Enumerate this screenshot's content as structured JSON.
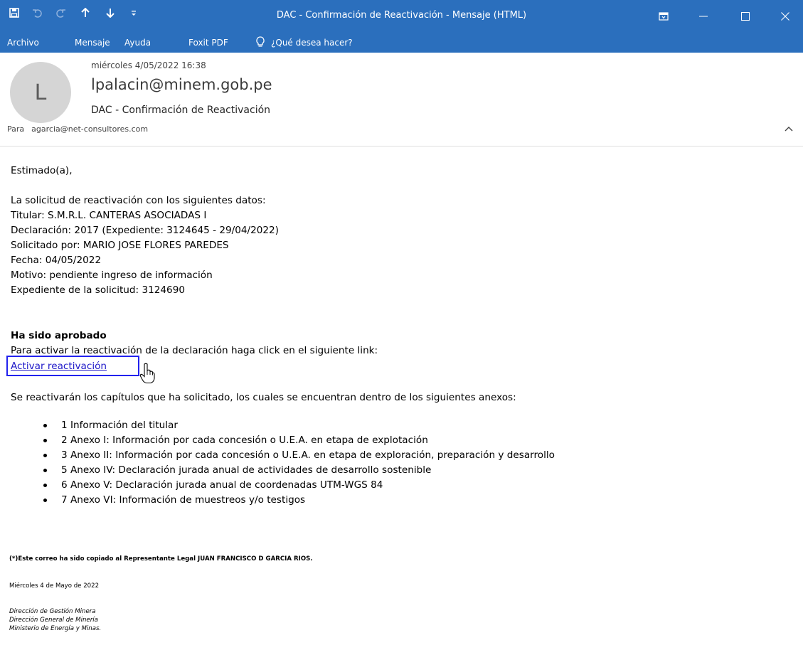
{
  "window": {
    "title": "DAC - Confirmación de Reactivación  -  Mensaje (HTML)",
    "qat_icons": [
      "save-icon",
      "undo-icon",
      "redo-icon",
      "up-arrow-icon",
      "down-arrow-icon",
      "customize-icon"
    ],
    "controls": [
      "ribbon-display-icon",
      "minimize-icon",
      "maximize-icon",
      "close-icon"
    ]
  },
  "ribbon": {
    "tabs": [
      "Archivo",
      "Mensaje",
      "Ayuda",
      "Foxit PDF"
    ],
    "tell_me": "¿Qué desea hacer?"
  },
  "message": {
    "date": "miércoles 4/05/2022 16:38",
    "avatar_initial": "L",
    "from": "lpalacin@minem.gob.pe",
    "subject": "DAC - Confirmación de Reactivación",
    "to_label": "Para",
    "to": "agarcia@net-consultores.com"
  },
  "body": {
    "greeting": "Estimado(a),",
    "intro": "La solicitud de reactivación con los siguientes datos:",
    "titular": "Titular: S.M.R.L. CANTERAS ASOCIADAS I",
    "declaracion": "Declaración: 2017 (Expediente: 3124645 - 29/04/2022)",
    "solicitado": "Solicitado por: MARIO JOSE FLORES PAREDES",
    "fecha": "Fecha: 04/05/2022",
    "motivo": "Motivo: pendiente ingreso de información",
    "expediente": "Expediente de la solicitud: 3124690",
    "status": "Ha sido aprobado",
    "instruction": "Para activar la reactivación de la declaración haga click en el siguiente link:",
    "link": "Activar reactivación",
    "capitulos": "Se reactivarán los capítulos que ha solicitado, los cuales se encuentran dentro de los siguientes anexos:",
    "anexos": [
      "1 Información del titular",
      "2 Anexo I: Información por cada concesión o U.E.A. en etapa de explotación",
      "3 Anexo II: Información por cada concesión o U.E.A. en etapa de exploración, preparación y desarrollo",
      "5 Anexo IV: Declaración jurada anual de actividades de desarrollo sostenible",
      "6 Anexo V: Declaración jurada anual de coordenadas UTM-WGS 84",
      "7 Anexo VI: Información de muestreos y/o testigos"
    ],
    "footer_note": "(*)Este correo ha sido copiado al Representante Legal JUAN FRANCISCO D GARCIA RIOS.",
    "footer_date": "Miércoles 4 de Mayo de 2022",
    "signature": [
      "Dirección de Gestión Minera",
      "Dirección General de Minería",
      "Ministerio de Energía y Minas."
    ]
  },
  "colors": {
    "titlebar": "#2b6fbd",
    "link": "#1d17c8",
    "link_highlight": "#2222ee",
    "avatar": "#d5d5d5"
  }
}
